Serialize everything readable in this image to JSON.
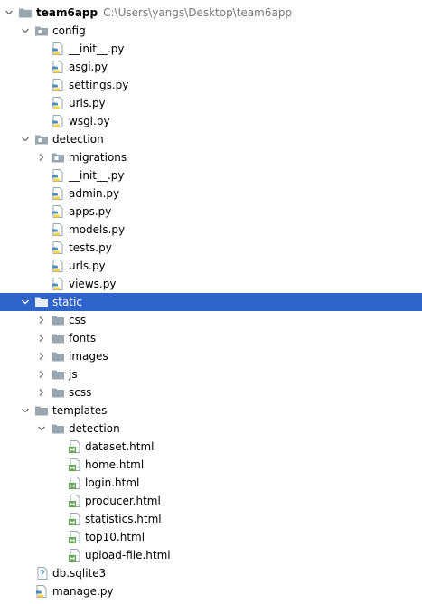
{
  "tree": [
    {
      "id": "team6app",
      "label": "team6app",
      "path": "C:\\Users\\yangs\\Desktop\\team6app",
      "depth": 0,
      "kind": "root",
      "arrow": "expanded"
    },
    {
      "id": "config",
      "label": "config",
      "depth": 1,
      "kind": "package",
      "arrow": "expanded"
    },
    {
      "id": "config-init",
      "label": "__init__.py",
      "depth": 2,
      "kind": "python"
    },
    {
      "id": "config-asgi",
      "label": "asgi.py",
      "depth": 2,
      "kind": "python"
    },
    {
      "id": "config-settings",
      "label": "settings.py",
      "depth": 2,
      "kind": "python"
    },
    {
      "id": "config-urls",
      "label": "urls.py",
      "depth": 2,
      "kind": "python"
    },
    {
      "id": "config-wsgi",
      "label": "wsgi.py",
      "depth": 2,
      "kind": "python"
    },
    {
      "id": "detection",
      "label": "detection",
      "depth": 1,
      "kind": "package",
      "arrow": "expanded"
    },
    {
      "id": "migrations",
      "label": "migrations",
      "depth": 2,
      "kind": "package",
      "arrow": "collapsed"
    },
    {
      "id": "detection-init",
      "label": "__init__.py",
      "depth": 2,
      "kind": "python"
    },
    {
      "id": "detection-admin",
      "label": "admin.py",
      "depth": 2,
      "kind": "python"
    },
    {
      "id": "detection-apps",
      "label": "apps.py",
      "depth": 2,
      "kind": "python"
    },
    {
      "id": "detection-models",
      "label": "models.py",
      "depth": 2,
      "kind": "python"
    },
    {
      "id": "detection-tests",
      "label": "tests.py",
      "depth": 2,
      "kind": "python"
    },
    {
      "id": "detection-urls",
      "label": "urls.py",
      "depth": 2,
      "kind": "python"
    },
    {
      "id": "detection-views",
      "label": "views.py",
      "depth": 2,
      "kind": "python"
    },
    {
      "id": "static",
      "label": "static",
      "depth": 1,
      "kind": "folder",
      "arrow": "expanded",
      "selected": true
    },
    {
      "id": "static-css",
      "label": "css",
      "depth": 2,
      "kind": "folder",
      "arrow": "collapsed"
    },
    {
      "id": "static-fonts",
      "label": "fonts",
      "depth": 2,
      "kind": "folder",
      "arrow": "collapsed"
    },
    {
      "id": "static-images",
      "label": "images",
      "depth": 2,
      "kind": "folder",
      "arrow": "collapsed"
    },
    {
      "id": "static-js",
      "label": "js",
      "depth": 2,
      "kind": "folder",
      "arrow": "collapsed"
    },
    {
      "id": "static-scss",
      "label": "scss",
      "depth": 2,
      "kind": "folder",
      "arrow": "collapsed"
    },
    {
      "id": "templates",
      "label": "templates",
      "depth": 1,
      "kind": "folder",
      "arrow": "expanded"
    },
    {
      "id": "templates-detection",
      "label": "detection",
      "depth": 2,
      "kind": "folder",
      "arrow": "expanded"
    },
    {
      "id": "dataset-html",
      "label": "dataset.html",
      "depth": 3,
      "kind": "html"
    },
    {
      "id": "home-html",
      "label": "home.html",
      "depth": 3,
      "kind": "html"
    },
    {
      "id": "login-html",
      "label": "login.html",
      "depth": 3,
      "kind": "html"
    },
    {
      "id": "producer-html",
      "label": "producer.html",
      "depth": 3,
      "kind": "html"
    },
    {
      "id": "statistics-html",
      "label": "statistics.html",
      "depth": 3,
      "kind": "html"
    },
    {
      "id": "top10-html",
      "label": "top10.html",
      "depth": 3,
      "kind": "html"
    },
    {
      "id": "upload-file-html",
      "label": "upload-file.html",
      "depth": 3,
      "kind": "html"
    },
    {
      "id": "db-sqlite3",
      "label": "db.sqlite3",
      "depth": 1,
      "kind": "unknown"
    },
    {
      "id": "manage-py",
      "label": "manage.py",
      "depth": 1,
      "kind": "python"
    }
  ],
  "colors": {
    "selection": "#2f65ca",
    "folder": "#9aa7b0",
    "python_blue": "#4b8bbe",
    "python_yellow": "#ffd43b",
    "html_green": "#5fa14f",
    "path_gray": "#787878"
  },
  "icons": {
    "arrow_expanded": "chevron-down-icon",
    "arrow_collapsed": "chevron-right-icon",
    "folder": "folder-icon",
    "package": "package-folder-icon",
    "python": "python-file-icon",
    "html": "html-file-icon",
    "unknown": "unknown-file-icon"
  }
}
